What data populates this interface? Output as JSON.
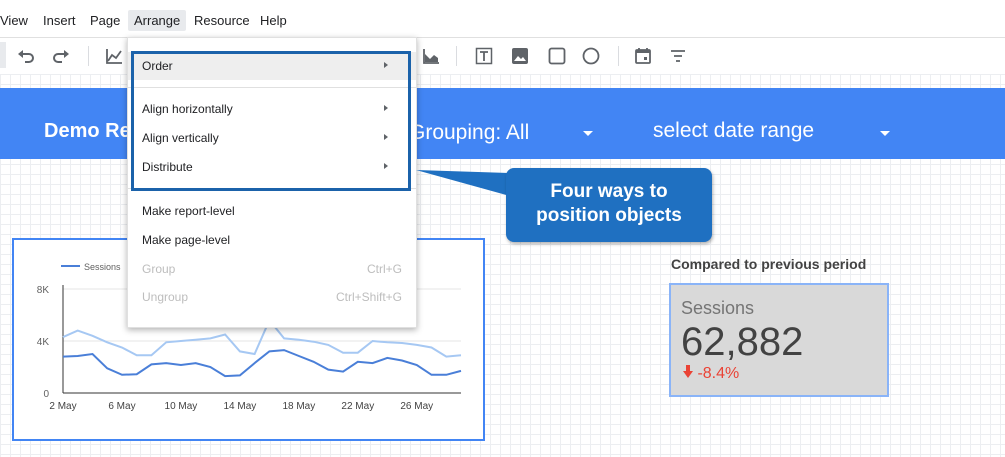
{
  "menu": {
    "items": [
      {
        "label": "View"
      },
      {
        "label": "Insert"
      },
      {
        "label": "Page"
      },
      {
        "label": "Arrange"
      },
      {
        "label": "Resource"
      },
      {
        "label": "Help"
      }
    ],
    "active": "Arrange"
  },
  "arrange_menu": {
    "order": "Order",
    "align_h": "Align horizontally",
    "align_v": "Align vertically",
    "distribute": "Distribute",
    "make_report_level": "Make report-level",
    "make_page_level": "Make page-level",
    "group": "Group",
    "group_shortcut": "Ctrl+G",
    "ungroup": "Ungroup",
    "ungroup_shortcut": "Ctrl+Shift+G"
  },
  "banner": {
    "title": "Demo Re",
    "grouping": "Grouping: All",
    "date": "select date range"
  },
  "callout": {
    "line1": "Four ways to",
    "line2": "position objects"
  },
  "scorecard": {
    "compare_label": "Compared to previous period",
    "title": "Sessions",
    "value": "62,882",
    "delta": "-8.4%"
  },
  "colors": {
    "banner": "#4285f4",
    "callout": "#1f70c1",
    "highlight_border": "#1b62aa",
    "series_current": "#4a7fd8",
    "series_previous": "#a6c8f3",
    "negative": "#ea4335"
  },
  "chart_data": {
    "type": "line",
    "legend": [
      "Sessions"
    ],
    "x": [
      "2 May",
      "3 May",
      "4 May",
      "5 May",
      "6 May",
      "7 May",
      "8 May",
      "9 May",
      "10 May",
      "11 May",
      "12 May",
      "13 May",
      "14 May",
      "15 May",
      "16 May",
      "17 May",
      "18 May",
      "19 May",
      "20 May",
      "21 May",
      "22 May",
      "23 May",
      "24 May",
      "25 May",
      "26 May",
      "27 May",
      "28 May",
      "29 May"
    ],
    "x_tick_labels": [
      "2 May",
      "6 May",
      "10 May",
      "14 May",
      "18 May",
      "22 May",
      "26 May"
    ],
    "y_tick_labels": [
      "8K",
      "4K",
      "0"
    ],
    "ylim": [
      0,
      8000
    ],
    "series": [
      {
        "name": "Sessions",
        "values": [
          2800,
          2850,
          3000,
          1900,
          1400,
          1450,
          2200,
          2300,
          2150,
          2300,
          2000,
          1300,
          1350,
          2300,
          3200,
          3300,
          2850,
          2400,
          1800,
          1650,
          2400,
          2300,
          2700,
          2500,
          2150,
          1400,
          1400,
          1700
        ]
      },
      {
        "values": [
          4300,
          4800,
          4400,
          3900,
          3500,
          2900,
          2900,
          3900,
          4000,
          4100,
          4200,
          4500,
          3200,
          3000,
          5600,
          4200,
          4100,
          3950,
          3700,
          3100,
          3100,
          4000,
          3900,
          3850,
          3700,
          3500,
          2800,
          2900
        ]
      }
    ]
  }
}
